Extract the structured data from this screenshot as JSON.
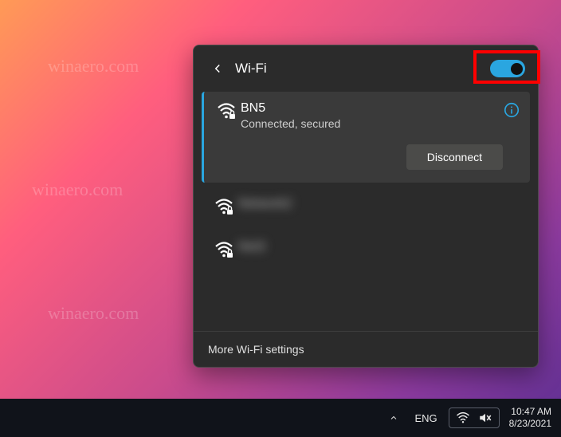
{
  "flyout": {
    "title": "Wi-Fi",
    "toggle_on": true,
    "footer_link": "More Wi-Fi settings",
    "disconnect_label": "Disconnect"
  },
  "networks": [
    {
      "name": "BN5",
      "status": "Connected, secured",
      "active": true,
      "secured": true
    },
    {
      "name": "[redacted]",
      "status": "",
      "active": false,
      "secured": true
    },
    {
      "name": "[redacted]",
      "status": "",
      "active": false,
      "secured": true
    }
  ],
  "taskbar": {
    "language": "ENG",
    "time": "10:47 AM",
    "date": "8/23/2021"
  },
  "watermark_text": "winaero.com"
}
